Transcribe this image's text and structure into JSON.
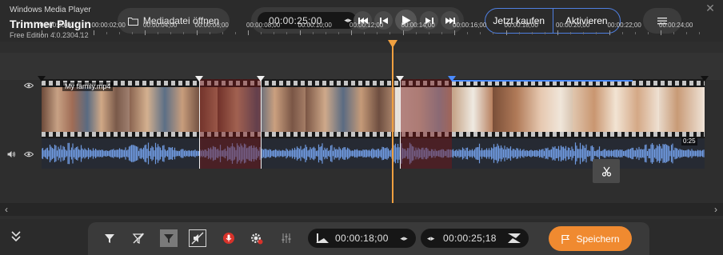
{
  "header": {
    "app_name": "Windows Media Player",
    "plugin_name": "Trimmer Plugin",
    "edition": "Free Edition 4.0.2304.12",
    "open_file_label": "Mediadatei öffnen",
    "current_time": "00:00:25;00",
    "buy_label": "Jetzt kaufen",
    "activate_label": "Aktivieren"
  },
  "timeline": {
    "ruler_labels": [
      "00:00:00;00",
      "00:00:02;00",
      "00:00:04;00",
      "00:00:06;00",
      "00:00:08;00",
      "00:00:10;00",
      "00:00:12;00",
      "00:00:14;00",
      "00:00:16;00",
      "00:00:18;00",
      "00:00:20;00",
      "00:00:22;00",
      "00:00:24;00"
    ],
    "clip_name": "My family.mp4",
    "clip_duration": "0:25",
    "playhead_seconds": 13.6,
    "segments": [
      {
        "state": "keep",
        "start_s": 0.0,
        "end_s": 6.1
      },
      {
        "state": "cut",
        "start_s": 6.1,
        "end_s": 8.5
      },
      {
        "state": "keep",
        "start_s": 8.5,
        "end_s": 13.9
      },
      {
        "state": "cut",
        "start_s": 13.9,
        "end_s": 15.9
      },
      {
        "state": "selected",
        "start_s": 15.9,
        "end_s": 22.9
      }
    ]
  },
  "bottom": {
    "start_time": "00:00:18;00",
    "end_time": "00:00:25;18",
    "save_label": "Speichern"
  },
  "colors": {
    "accent_orange": "#f08a30",
    "accent_blue": "#4f7fe0",
    "cut_red": "#781414",
    "playhead": "#f0a040"
  }
}
